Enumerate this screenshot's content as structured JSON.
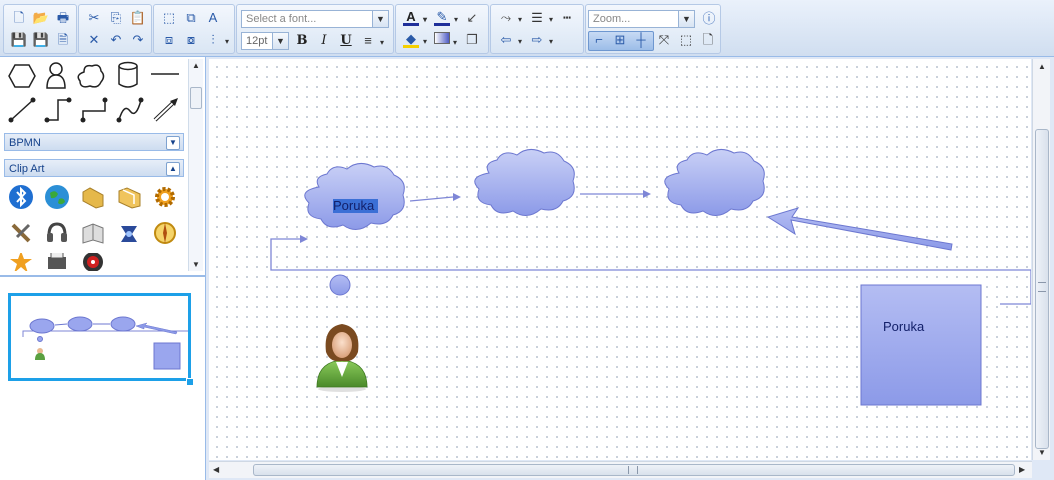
{
  "toolbar": {
    "font_placeholder": "Select a font...",
    "font_size": "12pt",
    "zoom_placeholder": "Zoom...",
    "bold": "B",
    "italic": "I",
    "underline": "U"
  },
  "sidebar": {
    "panels": [
      {
        "title": "BPMN",
        "state": "collapsed"
      },
      {
        "title": "Clip Art",
        "state": "expanded"
      }
    ]
  },
  "diagram": {
    "cloud1_label": "Poruka",
    "rect_label": "Poruka"
  },
  "colors": {
    "accent": "#1da0e8",
    "shape_fill_top": "#c9d0f6",
    "shape_fill_bottom": "#8c9ae8",
    "connector": "#7e86d6"
  }
}
